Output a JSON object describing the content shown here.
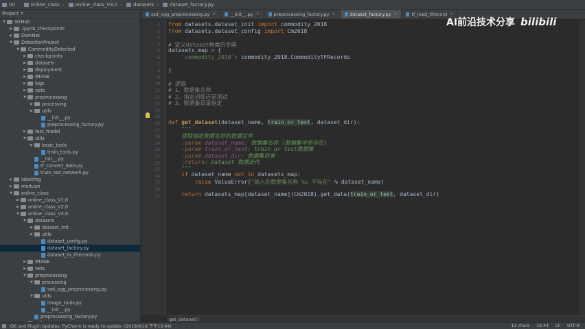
{
  "breadcrumbs": [
    "ml",
    "online_class",
    "online_class_V3.0",
    "datasets",
    "dataset_factory.py"
  ],
  "project": {
    "title": "Project",
    "tree": [
      {
        "label": "GitHub",
        "depth": 0,
        "kind": "folder",
        "open": true
      },
      {
        "label": ".ipynb_checkpoints",
        "depth": 1,
        "kind": "folder",
        "open": false
      },
      {
        "label": "DarkNet",
        "depth": 1,
        "kind": "folder",
        "open": false
      },
      {
        "label": "DetectionProject",
        "depth": 1,
        "kind": "folder",
        "open": true
      },
      {
        "label": "CommodityDetected",
        "depth": 2,
        "kind": "folder",
        "open": true
      },
      {
        "label": "checkpoints",
        "depth": 3,
        "kind": "folder",
        "open": false
      },
      {
        "label": "datasets",
        "depth": 3,
        "kind": "folder",
        "open": false
      },
      {
        "label": "deployment",
        "depth": 3,
        "kind": "folder",
        "open": false
      },
      {
        "label": "IMAGE",
        "depth": 3,
        "kind": "folder",
        "open": false
      },
      {
        "label": "logs",
        "depth": 3,
        "kind": "folder",
        "open": false
      },
      {
        "label": "nets",
        "depth": 3,
        "kind": "folder",
        "open": false
      },
      {
        "label": "preprocessing",
        "depth": 3,
        "kind": "folder",
        "open": true
      },
      {
        "label": "processing",
        "depth": 4,
        "kind": "folder",
        "open": false
      },
      {
        "label": "utils",
        "depth": 4,
        "kind": "folder",
        "open": false
      },
      {
        "label": "__init__.py",
        "depth": 5,
        "kind": "file"
      },
      {
        "label": "preprocessing_factory.py",
        "depth": 5,
        "kind": "file"
      },
      {
        "label": "test_model",
        "depth": 3,
        "kind": "folder",
        "open": false
      },
      {
        "label": "utils",
        "depth": 3,
        "kind": "folder",
        "open": true
      },
      {
        "label": "basic_tools",
        "depth": 4,
        "kind": "folder",
        "open": false
      },
      {
        "label": "train_tools.py",
        "depth": 5,
        "kind": "file"
      },
      {
        "label": "__init__.py",
        "depth": 4,
        "kind": "file"
      },
      {
        "label": "tf_convert_data.py",
        "depth": 4,
        "kind": "file"
      },
      {
        "label": "train_ssd_network.py",
        "depth": 4,
        "kind": "file"
      },
      {
        "label": "labelImg",
        "depth": 1,
        "kind": "folder",
        "open": false
      },
      {
        "label": "meituan",
        "depth": 1,
        "kind": "folder",
        "open": false
      },
      {
        "label": "online_class",
        "depth": 1,
        "kind": "folder",
        "open": true
      },
      {
        "label": "online_class_V1.0",
        "depth": 2,
        "kind": "folder",
        "open": false
      },
      {
        "label": "online_class_V2.0",
        "depth": 2,
        "kind": "folder",
        "open": false
      },
      {
        "label": "online_class_V3.0",
        "depth": 2,
        "kind": "folder",
        "open": true
      },
      {
        "label": "datasets",
        "depth": 3,
        "kind": "folder",
        "open": true
      },
      {
        "label": "dataset_init",
        "depth": 4,
        "kind": "folder",
        "open": false
      },
      {
        "label": "utils",
        "depth": 4,
        "kind": "folder",
        "open": false
      },
      {
        "label": "dataset_config.py",
        "depth": 5,
        "kind": "file"
      },
      {
        "label": "dataset_factory.py",
        "depth": 5,
        "kind": "file",
        "selected": true
      },
      {
        "label": "dataset_to_tfrecords.py",
        "depth": 5,
        "kind": "file"
      },
      {
        "label": "IMAGE",
        "depth": 3,
        "kind": "folder",
        "open": false
      },
      {
        "label": "nets",
        "depth": 3,
        "kind": "folder",
        "open": false
      },
      {
        "label": "preprocessing",
        "depth": 3,
        "kind": "folder",
        "open": true
      },
      {
        "label": "processing",
        "depth": 4,
        "kind": "folder",
        "open": true
      },
      {
        "label": "ssd_vgg_preprocessing.py",
        "depth": 5,
        "kind": "file"
      },
      {
        "label": "utils",
        "depth": 4,
        "kind": "folder",
        "open": true
      },
      {
        "label": "image_tools.py",
        "depth": 5,
        "kind": "file"
      },
      {
        "label": "__init__.py",
        "depth": 5,
        "kind": "file"
      },
      {
        "label": "preprocessing_factory.py",
        "depth": 4,
        "kind": "file"
      },
      {
        "label": "utils",
        "depth": 3,
        "kind": "folder",
        "open": false
      }
    ]
  },
  "tabs": [
    {
      "label": "ssd_vgg_preprocessing.py",
      "active": false
    },
    {
      "label": "__init__.py",
      "active": false
    },
    {
      "label": "preprocessing_factory.py",
      "active": false
    },
    {
      "label": "dataset_factory.py",
      "active": true
    },
    {
      "label": "tf_read_tfrecord",
      "active": false
    }
  ],
  "line_numbers": [
    "1",
    "2",
    "3",
    "4",
    "5",
    "6",
    "7",
    "8",
    "9",
    "10",
    "11",
    "12",
    "13",
    "14",
    "15",
    "16",
    "17",
    "18",
    "19",
    "20",
    "21",
    "22",
    "23",
    "24",
    "25",
    "26",
    "27"
  ],
  "code": {
    "l1_kw": "from",
    "l1_a": " datasets.dataset_init ",
    "l1_kw2": "import",
    "l1_b": " commodity_2018",
    "l2_kw": "from",
    "l2_a": " datasets.dataset_config ",
    "l2_kw2": "import",
    "l2_b": " Cm2018",
    "l4": "# 定义dataset种类的字典",
    "l5": "datasets_map = {",
    "l6_str": "    'commodity_2018'",
    "l6_rest": ": commodity_2018.CommodityTFRecords",
    "l8": "}",
    "l11": "# 逻辑",
    "l12": "# 1、数据集名称",
    "l13": "# 2、指定训练还是测试",
    "l14": "# 3、数据集目录指定",
    "l16_kw": "def ",
    "l16_fn": "get_dataset",
    "l16_a": "(dataset_name, ",
    "l16_hl": "train_or_test",
    "l16_b": ", dataset_dir):",
    "l17": "    \"\"\"",
    "l18": "    获取指定数据名称的数据文件",
    "l19_tag": "    :param ",
    "l19_p": "dataset_name",
    "l19_d": ": 数据集名称 (数据集中参存在)",
    "l20_tag": "    :param ",
    "l20_p": "train_or_test",
    "l20_d": ": train or test数据集",
    "l21_tag": "    :param ",
    "l21_p": "dataset_dir",
    "l21_d": ": 数据集目录",
    "l22_tag": "    :return",
    "l22_d": ": Dataset 数据迭代",
    "l23": "    \"\"\"",
    "l24_kw": "    if ",
    "l24_a": "dataset_name ",
    "l24_kw2": "not in",
    "l24_b": " datasets_map:",
    "l25_kw": "        raise ",
    "l25_a": "ValueError(",
    "l25_str": "\"输入的数据集名称 %s 不存在\"",
    "l25_b": " % dataset_name)",
    "l27_kw": "    return ",
    "l27_a": "datasets_map[dataset_name](Cm2018).get_data(",
    "l27_hl": "train_or_test",
    "l27_b": ", dataset_dir)"
  },
  "editor_breadcrumb": "get_dataset()",
  "watermark": {
    "text": "AI前沿技术分享",
    "logo": "bilibili"
  },
  "status": {
    "message": "IDE and Plugin Updates: PyCharm is ready to update. (2018/9/18 下午10:04)",
    "chars": "13 chars",
    "position": "16:44",
    "line_sep": "LF",
    "encoding": "UTF-8"
  }
}
